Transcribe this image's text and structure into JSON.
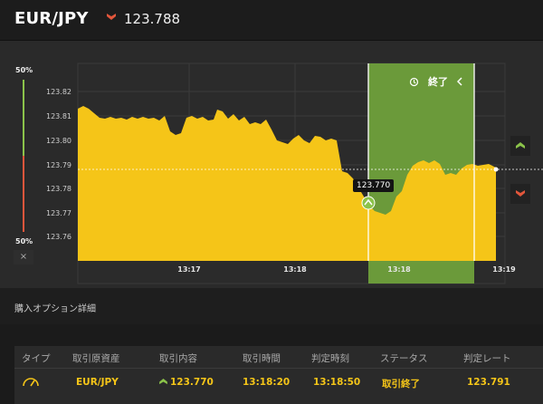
{
  "header": {
    "pair": "EUR/JPY",
    "price": "123.788",
    "price_direction_icon": "down-arrow-icon",
    "direction_color": "#e2563b"
  },
  "chart": {
    "y_ticks": [
      "123.82",
      "123.81",
      "123.80",
      "123.79",
      "123.78",
      "123.77",
      "123.76"
    ],
    "x_ticks": [
      "13:17",
      "13:18",
      "13:18",
      "13:19"
    ],
    "entry_label": "123.770",
    "end_label": "終了",
    "end_icon": "history-icon",
    "area_color": "#f5c518",
    "window_color": "#6b9a3a",
    "current_price_line": "123.788"
  },
  "percent": {
    "top": "50%",
    "bottom": "50%",
    "close_icon": "×"
  },
  "side_buttons": {
    "up_icon": "up-arrow-icon",
    "down_icon": "down-arrow-icon"
  },
  "details": {
    "title": "購入オプション詳細",
    "headers": [
      "タイプ",
      "取引原資産",
      "取引内容",
      "取引時間",
      "判定時刻",
      "ステータス",
      "判定レート"
    ],
    "row": {
      "type_icon": "gauge-icon",
      "asset": "EUR/JPY",
      "content": "123.770",
      "content_icon": "up-arrow-icon",
      "trade_time": "13:18:20",
      "judge_time": "13:18:50",
      "status": "取引終了",
      "rate": "123.791"
    }
  }
}
